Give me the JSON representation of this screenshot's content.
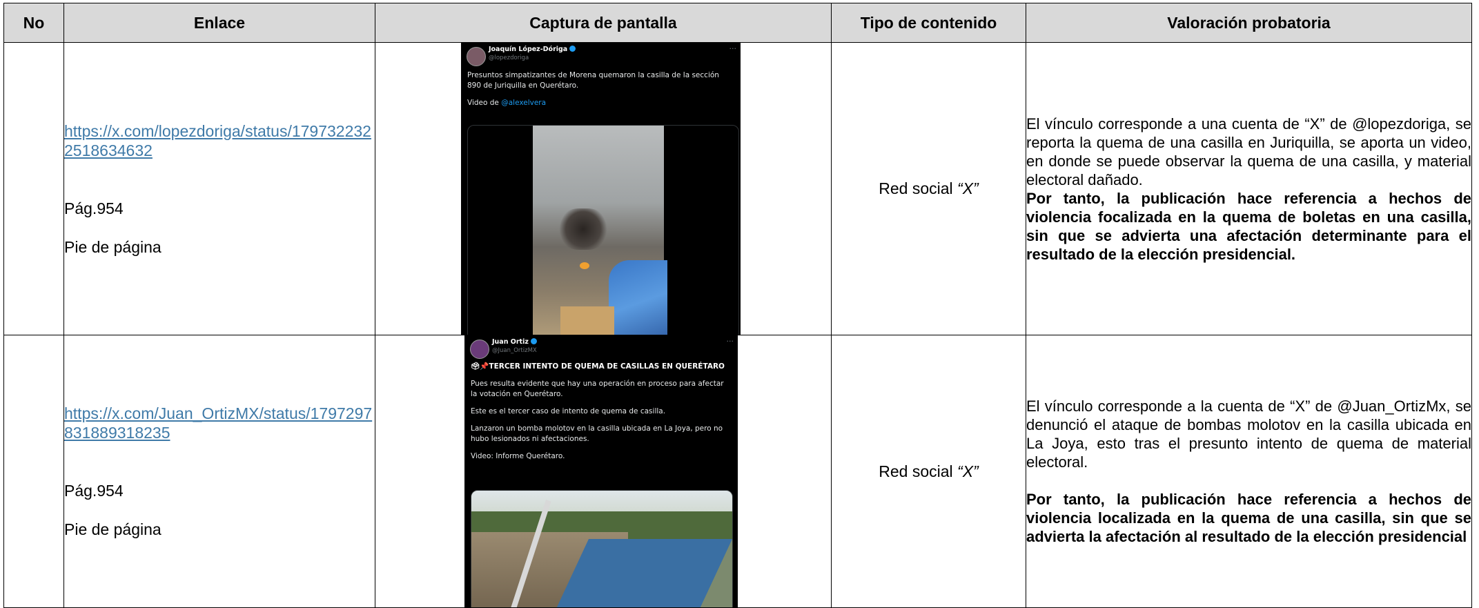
{
  "headers": {
    "no": "No",
    "enlace": "Enlace",
    "captura": "Captura de pantalla",
    "tipo": "Tipo de contenido",
    "valoracion": "Valoración probatoria"
  },
  "rows": [
    {
      "no": "",
      "link": "https://x.com/lopezdoriga/status/1797322322518634632",
      "pag": "Pág.954",
      "pie": "Pie de página",
      "tipo_prefix": "Red social ",
      "tipo_quoted": "“X”",
      "valoracion_normal": "El vínculo corresponde a una cuenta de “X” de @lopezdoriga, se reporta la quema de una casilla en Juriquilla, se aporta un video, en donde se puede observar la quema de una casilla, y material electoral dañado.",
      "valoracion_bold": "Por tanto, la publicación hace referencia a hechos de violencia focalizada en la quema de boletas en una casilla, sin que se advierta una afectación determinante para el resultado de la elección presidencial.",
      "tweet": {
        "name": "Joaquín López-Dóriga",
        "handle": "@lopezdoriga",
        "text": "Presuntos simpatizantes de Morena quemaron la casilla de la sección 890 de Juriquilla en Querétaro.",
        "video_prefix": "Video de ",
        "video_mention": "@alexelvera"
      }
    },
    {
      "no": "",
      "link": "https://x.com/Juan_OrtizMX/status/1797297831889318235",
      "pag": "Pág.954",
      "pie": "Pie de página",
      "tipo_prefix": "Red social ",
      "tipo_quoted": "“X”",
      "valoracion_normal": "El vínculo corresponde a la cuenta de “X” de @Juan_OrtizMx, se denunció el ataque de bombas molotov en la casilla ubicada en La Joya, esto tras el presunto intento de quema de material electoral.",
      "valoracion_bold": "Por tanto, la publicación hace referencia a hechos de violencia localizada en la quema de una casilla, sin que se advierta la afectación al resultado de la elección presidencial",
      "tweet": {
        "name": "Juan Ortiz",
        "handle": "@Juan_OrtizMX",
        "headline": "TERCER INTENTO DE QUEMA DE CASILLAS EN QUERÉTARO",
        "p1": "Pues resulta evidente que hay una operación en proceso para afectar la votación en Querétaro.",
        "p2": "Este es el tercer caso de intento de quema de casilla.",
        "p3": "Lanzaron un bomba molotov en la casilla ubicada en La Joya, pero no hubo lesionados ni afectaciones.",
        "p4": "Video: Informe Querétaro."
      }
    }
  ]
}
